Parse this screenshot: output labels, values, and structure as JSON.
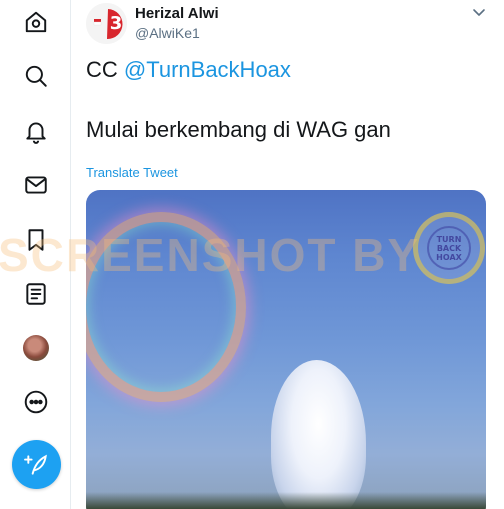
{
  "sidebar": {
    "items": [
      {
        "name": "home",
        "icon": "home-icon"
      },
      {
        "name": "explore",
        "icon": "search-icon"
      },
      {
        "name": "notifications",
        "icon": "bell-icon"
      },
      {
        "name": "messages",
        "icon": "envelope-icon"
      },
      {
        "name": "bookmarks",
        "icon": "bookmark-icon"
      },
      {
        "name": "lists",
        "icon": "list-icon"
      },
      {
        "name": "profile",
        "icon": "avatar"
      },
      {
        "name": "more",
        "icon": "more-icon"
      }
    ],
    "compose_icon": "feather-plus-icon"
  },
  "tweet": {
    "author_name": "Herizal Alwi",
    "author_handle": "@AlwiKe1",
    "text_prefix": "CC ",
    "mention": "@TurnBackHoax",
    "text_line2": "Mulai berkembang di WAG gan",
    "translate_label": "Translate Tweet",
    "avatar_badge": "3"
  },
  "media": {
    "seal_line1": "TURN",
    "seal_line2": "BACK",
    "seal_line3": "HOAX"
  },
  "watermark": "SCREENSHOT BY",
  "colors": {
    "accent": "#1da1f2",
    "link": "#1b95e0",
    "secondary_text": "#5b7083"
  }
}
